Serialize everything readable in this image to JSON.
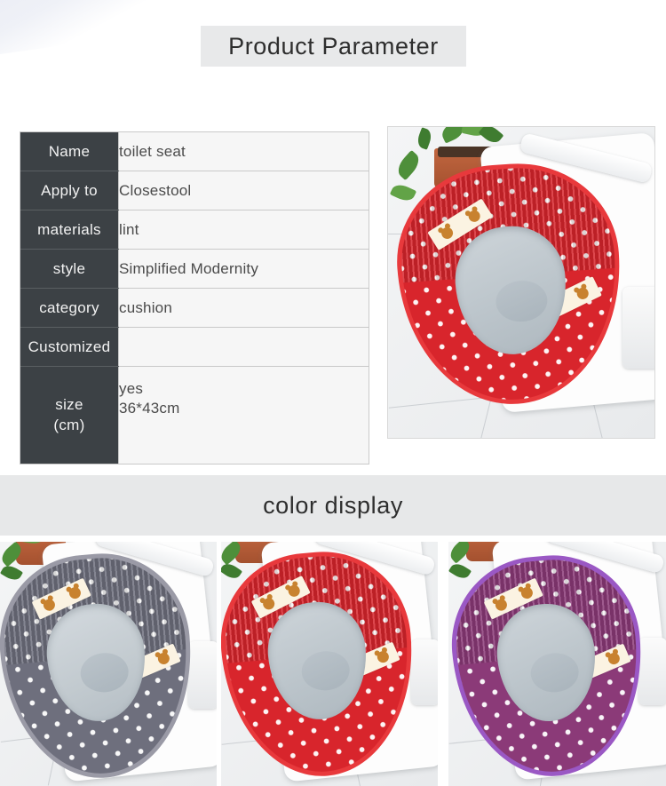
{
  "sections": {
    "parameter_title": "Product Parameter",
    "color_title": "color display"
  },
  "parameter_table": {
    "rows": [
      {
        "label": "Name",
        "value": "toilet seat"
      },
      {
        "label": "Apply to",
        "value": "Closestool"
      },
      {
        "label": "materials",
        "value": "lint"
      },
      {
        "label": "style",
        "value": "Simplified Modernity"
      },
      {
        "label": "category",
        "value": "cushion"
      },
      {
        "label": "Customized",
        "value": ""
      }
    ],
    "size_row": {
      "label_line1": "size",
      "label_line2": "(cm)",
      "value_line1": "yes",
      "value_line2": "36*43cm"
    }
  },
  "main_photo": {
    "caption": "red polka dot toilet seat cover on closestool",
    "cushion_color": "#d8252c",
    "piping_color": "#e8393c",
    "dot_color": "#ffffff",
    "patch_color": "#fbf3e2",
    "bear_color": "#c8822f",
    "bowl_color": "#c2cacf"
  },
  "color_variants": [
    {
      "name": "gray",
      "cushion_color": "#6e6f7d",
      "piping_color": "#9a9aa6",
      "bowl_color": "#c5ccd1"
    },
    {
      "name": "red",
      "cushion_color": "#d8252c",
      "piping_color": "#e8393c",
      "bowl_color": "#c2cacf"
    },
    {
      "name": "purple",
      "cushion_color": "#8b3a78",
      "piping_color": "#9a58c4",
      "bowl_color": "#c2cacf"
    }
  ]
}
